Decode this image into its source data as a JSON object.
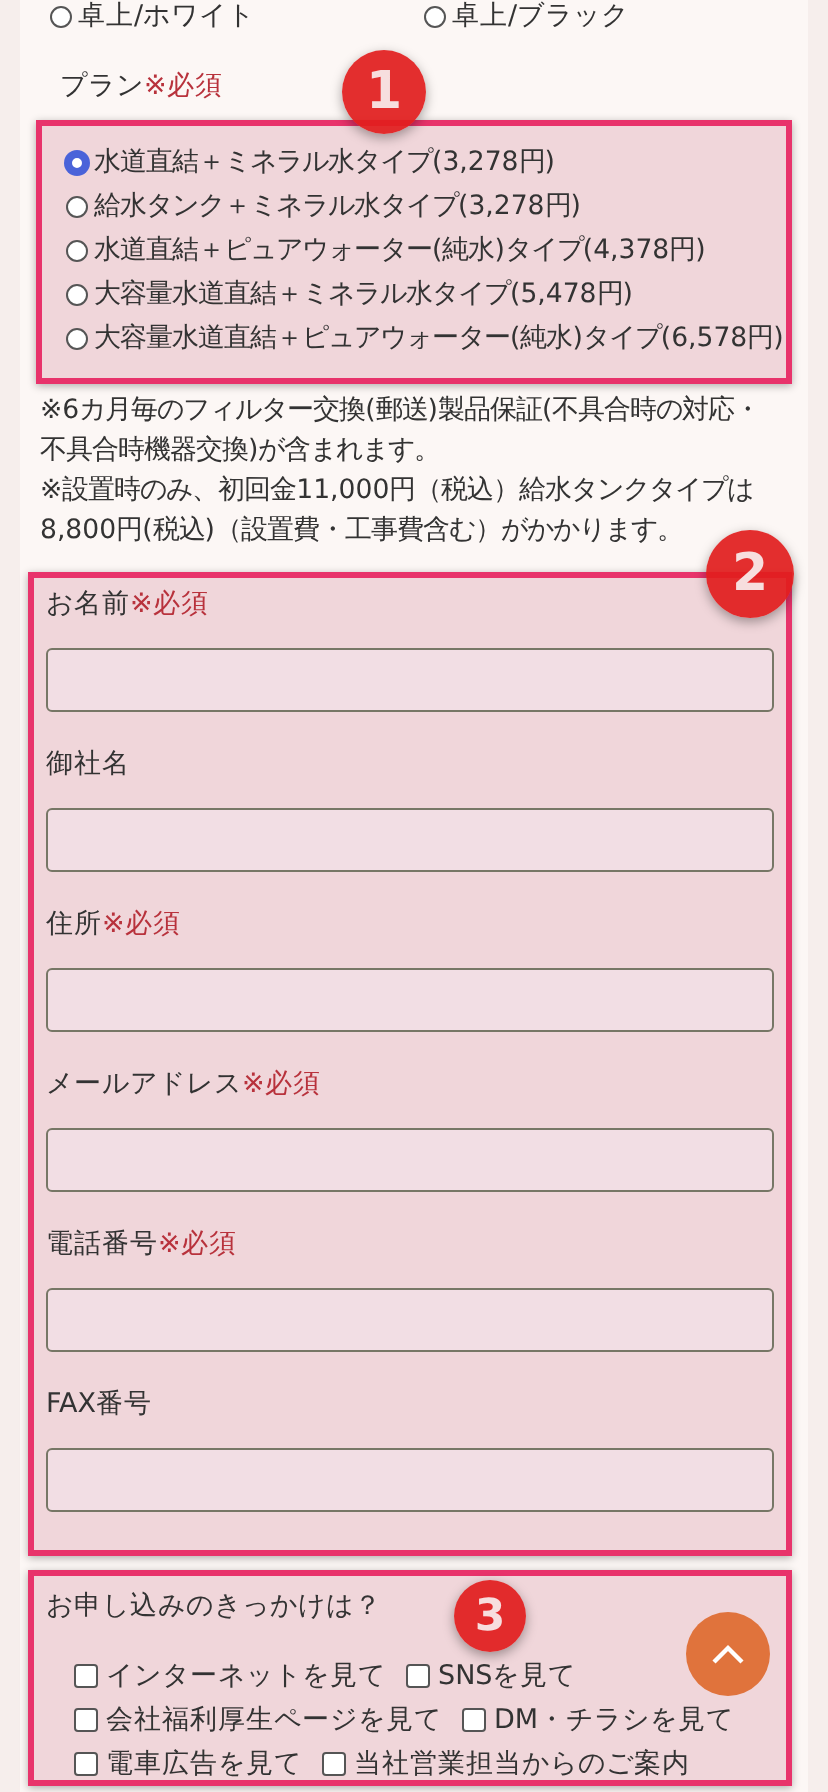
{
  "top_options": [
    {
      "label": "卓上/ホワイト",
      "selected": false
    },
    {
      "label": "卓上/ブラック",
      "selected": false
    }
  ],
  "plan": {
    "label": "プラン",
    "required": "※必須",
    "options": [
      {
        "label": "水道直結＋ミネラル水タイプ(3,278円)",
        "selected": true
      },
      {
        "label": "給水タンク＋ミネラル水タイプ(3,278円)",
        "selected": false
      },
      {
        "label": "水道直結＋ピュアウォーター(純水)タイプ(4,378円)",
        "selected": false
      },
      {
        "label": "大容量水道直結＋ミネラル水タイプ(5,478円)",
        "selected": false
      },
      {
        "label": "大容量水道直結＋ピュアウォーター(純水)タイプ(6,578円)",
        "selected": false
      }
    ]
  },
  "notes": [
    "※6カ月毎のフィルター交換(郵送)製品保証(不具合時の対応・不具合時機器交換)が含まれます。",
    "※設置時のみ、初回金11,000円（税込）給水タンクタイプは8,800円(税込)（設置費・工事費含む）がかかります。"
  ],
  "fields": [
    {
      "label": "お名前",
      "required": "※必須"
    },
    {
      "label": "御社名"
    },
    {
      "label": "住所",
      "required": "※必須"
    },
    {
      "label": "メールアドレス",
      "required": "※必須"
    },
    {
      "label": "電話番号",
      "required": "※必須"
    },
    {
      "label": "FAX番号"
    }
  ],
  "source": {
    "label": "お申し込みのきっかけは？",
    "rows": [
      [
        {
          "label": "インターネットを見て",
          "checked": false
        },
        {
          "label": "SNSを見て",
          "checked": false
        }
      ],
      [
        {
          "label": "会社福利厚生ページを見て",
          "checked": false
        },
        {
          "label": "DM・チラシを見て",
          "checked": false
        }
      ],
      [
        {
          "label": "電車広告を見て",
          "checked": false
        },
        {
          "label": "当社営業担当からのご案内",
          "checked": false
        }
      ]
    ]
  },
  "annotations": [
    "1",
    "2",
    "3"
  ]
}
